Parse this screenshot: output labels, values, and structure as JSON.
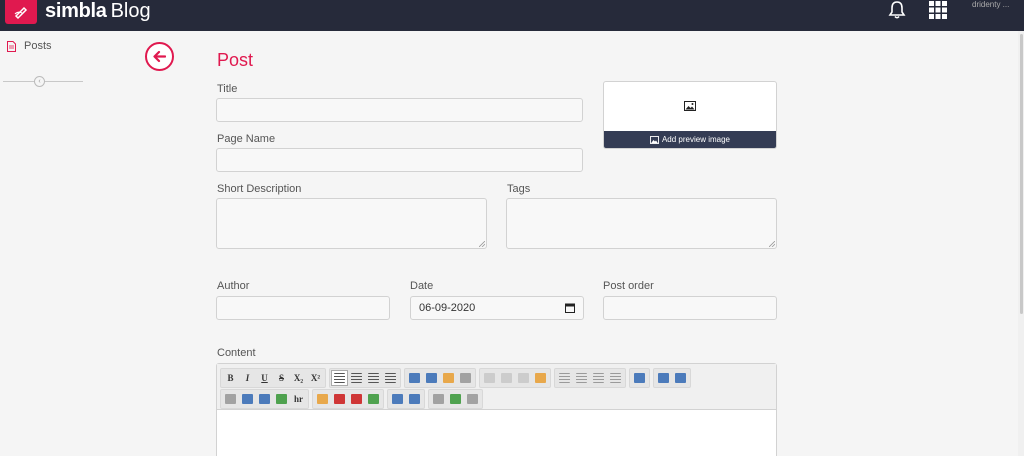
{
  "brand": {
    "name": "simbla",
    "product": "Blog"
  },
  "user": {
    "name": "dridenty ..."
  },
  "sidebar": {
    "items": [
      {
        "label": "Posts"
      }
    ]
  },
  "page": {
    "title": "Post"
  },
  "form": {
    "title_label": "Title",
    "title_value": "",
    "page_name_label": "Page Name",
    "page_name_value": "",
    "short_description_label": "Short Description",
    "tags_label": "Tags",
    "author_label": "Author",
    "author_value": "",
    "date_label": "Date",
    "date_value": "06-09-2020",
    "post_order_label": "Post order",
    "post_order_value": "",
    "content_label": "Content"
  },
  "preview": {
    "button_label": "Add preview image"
  },
  "editor": {
    "row1": [
      [
        "B",
        "I",
        "U",
        "S",
        "X₂",
        "X²"
      ],
      [
        "align-left",
        "align-center",
        "align-right",
        "align-justify"
      ],
      [
        "text-color",
        "bg-color",
        "format",
        "remove-format"
      ],
      [
        "cut",
        "copy",
        "paste",
        "paste-word"
      ],
      [
        "bullet-list",
        "numbered-list",
        "outdent",
        "indent"
      ],
      [
        "link"
      ],
      [
        "source",
        "comment"
      ]
    ],
    "row2": [
      [
        "form",
        "image",
        "table",
        "flash",
        "hr"
      ],
      [
        "smiley",
        "youtube",
        "calendar",
        "special-char"
      ],
      [
        "ltr",
        "rtl"
      ],
      [
        "print",
        "maximize",
        "preview"
      ]
    ],
    "colors": {
      "blue": "#3b6fb6",
      "green": "#3e9a3e",
      "orange": "#e8a13a",
      "red": "#cc2222",
      "gray": "#9a9a9a"
    }
  },
  "colors": {
    "accent": "#e0194f",
    "topbar": "#262a3a",
    "preview_button": "#343c54"
  }
}
